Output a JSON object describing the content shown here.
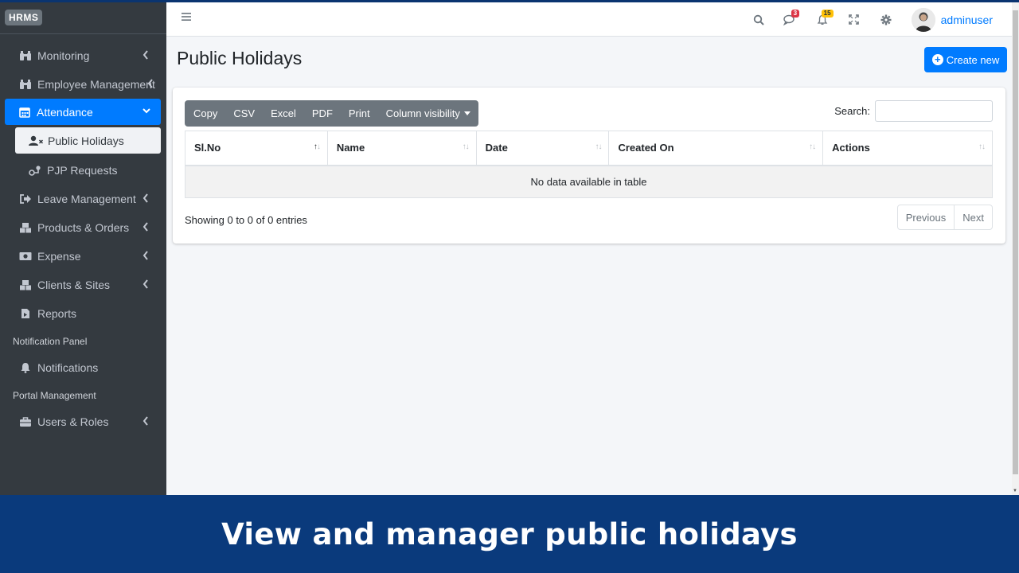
{
  "brand": "HRMS",
  "sidebar": {
    "items": [
      {
        "label": "Monitoring",
        "icon": "binoculars-icon",
        "chevron": "left"
      },
      {
        "label": "Employee Management",
        "icon": "binoculars-icon",
        "chevron": "left"
      },
      {
        "label": "Attendance",
        "icon": "calendar-icon",
        "chevron": "down",
        "active": true
      },
      {
        "label": "Public Holidays",
        "icon": "user-times-icon",
        "sub": true,
        "active": true
      },
      {
        "label": "PJP Requests",
        "icon": "route-icon",
        "sub": true
      },
      {
        "label": "Leave Management",
        "icon": "sign-out-icon",
        "chevron": "left"
      },
      {
        "label": "Products & Orders",
        "icon": "boxes-icon",
        "chevron": "left"
      },
      {
        "label": "Expense",
        "icon": "money-bill-icon",
        "chevron": "left"
      },
      {
        "label": "Clients & Sites",
        "icon": "boxes-icon",
        "chevron": "left"
      },
      {
        "label": "Reports",
        "icon": "file-icon"
      }
    ],
    "header_notification": "Notification Panel",
    "notifications_label": "Notifications",
    "header_portal": "Portal Management",
    "users_roles_label": "Users & Roles"
  },
  "navbar": {
    "messages_count": "3",
    "notifications_count": "15",
    "username": "adminuser"
  },
  "page": {
    "title": "Public Holidays",
    "create_label": "Create new"
  },
  "table": {
    "buttons": [
      "Copy",
      "CSV",
      "Excel",
      "PDF",
      "Print",
      "Column visibility"
    ],
    "search_label": "Search:",
    "search_value": "",
    "columns": [
      "Sl.No",
      "Name",
      "Date",
      "Created On",
      "Actions"
    ],
    "empty_message": "No data available in table",
    "info": "Showing 0 to 0 of 0 entries",
    "prev_label": "Previous",
    "next_label": "Next"
  },
  "colors": {
    "primary": "#007bff",
    "sidebar": "#343a40",
    "banner": "#0a3a7c",
    "badge_danger": "#dc3545",
    "badge_warning": "#ffc107"
  },
  "banner": {
    "text": "View and manager public holidays"
  }
}
